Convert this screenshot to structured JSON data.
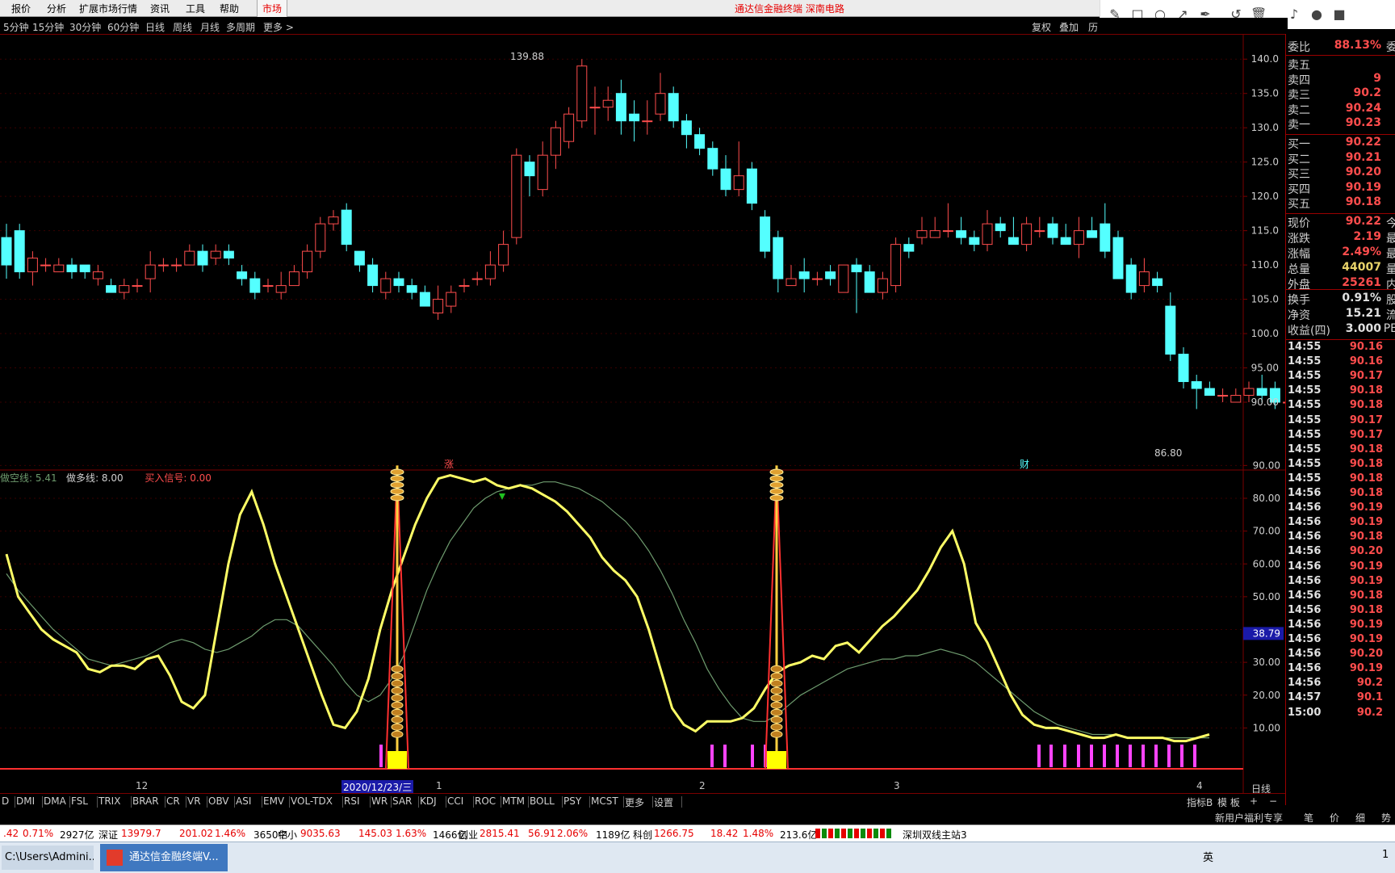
{
  "menu": {
    "items": [
      "报价",
      "分析",
      "扩展市场行情",
      "资讯",
      "工具",
      "帮助"
    ],
    "market": "市场",
    "title": "通达信金融终端  深南电路"
  },
  "periods": [
    "5分钟",
    "15分钟",
    "30分钟",
    "60分钟",
    "日线",
    "周线",
    "月线",
    "多周期",
    "更多 >"
  ],
  "period_right": [
    "复权",
    "叠加",
    "历"
  ],
  "chart": {
    "high_label": "139.88",
    "low_label": "86.80",
    "marker_zhang": "涨",
    "marker_cai": "财",
    "price_ticks": [
      "140.0",
      "135.0",
      "130.0",
      "125.0",
      "120.0",
      "115.0",
      "110.0",
      "105.0",
      "100.0",
      "95.00",
      "90.00"
    ],
    "ind_ticks": [
      "90.00",
      "80.00",
      "70.00",
      "60.00",
      "50.00",
      "40.00",
      "30.00",
      "20.00",
      "10.00"
    ],
    "cursor_value": "38.79",
    "x_labels": [
      "12",
      "2020/12/23/三",
      "1",
      "2",
      "3",
      "4"
    ],
    "period_label": "日线"
  },
  "chart_data": {
    "type": "candlestick",
    "price_axis": {
      "min": 86,
      "max": 140
    },
    "candles": [
      [
        114,
        110,
        116,
        108
      ],
      [
        115,
        109,
        116,
        108
      ],
      [
        109,
        111,
        112,
        107
      ],
      [
        110,
        110,
        111,
        109
      ],
      [
        109,
        110,
        111,
        109
      ],
      [
        110,
        109,
        111,
        108
      ],
      [
        110,
        109,
        110,
        108
      ],
      [
        108,
        109,
        110,
        107
      ],
      [
        107,
        106,
        108,
        106
      ],
      [
        106,
        107,
        108,
        105
      ],
      [
        107,
        107,
        108,
        106
      ],
      [
        108,
        110,
        112,
        106
      ],
      [
        110,
        110,
        111,
        109
      ],
      [
        110,
        110,
        111,
        109
      ],
      [
        110,
        112,
        113,
        110
      ],
      [
        112,
        110,
        113,
        109
      ],
      [
        111,
        112,
        113,
        110
      ],
      [
        112,
        111,
        113,
        110
      ],
      [
        109,
        108,
        110,
        107
      ],
      [
        108,
        106,
        109,
        105
      ],
      [
        107,
        107,
        108,
        106
      ],
      [
        106,
        107,
        109,
        105
      ],
      [
        107,
        109,
        110,
        107
      ],
      [
        109,
        112,
        113,
        108
      ],
      [
        112,
        116,
        117,
        111
      ],
      [
        116,
        117,
        118,
        115
      ],
      [
        118,
        113,
        119,
        112
      ],
      [
        112,
        110,
        112,
        109
      ],
      [
        110,
        107,
        111,
        106
      ],
      [
        106,
        108,
        109,
        105
      ],
      [
        108,
        107,
        109,
        106
      ],
      [
        107,
        106,
        108,
        105
      ],
      [
        106,
        104,
        107,
        104
      ],
      [
        103,
        105,
        107,
        102
      ],
      [
        104,
        106,
        107,
        103
      ],
      [
        107,
        107,
        108,
        106
      ],
      [
        108,
        108,
        109,
        107
      ],
      [
        108,
        110,
        112,
        107
      ],
      [
        110,
        113,
        115,
        109
      ],
      [
        114,
        126,
        127,
        113
      ],
      [
        125,
        123,
        126,
        120
      ],
      [
        121,
        126,
        128,
        120
      ],
      [
        126,
        130,
        131,
        124
      ],
      [
        128,
        132,
        133,
        127
      ],
      [
        131,
        139,
        140,
        130
      ],
      [
        133,
        133,
        136,
        129
      ],
      [
        133,
        134,
        136,
        131
      ],
      [
        135,
        131,
        137,
        129
      ],
      [
        132,
        131,
        134,
        128
      ],
      [
        131,
        131,
        134,
        129
      ],
      [
        132,
        135,
        138,
        131
      ],
      [
        135,
        131,
        136,
        130
      ],
      [
        131,
        129,
        132,
        127
      ],
      [
        129,
        127,
        130,
        126
      ],
      [
        127,
        124,
        128,
        123
      ],
      [
        124,
        121,
        126,
        120
      ],
      [
        121,
        123,
        128,
        120
      ],
      [
        124,
        119,
        125,
        118
      ],
      [
        117,
        112,
        118,
        111
      ],
      [
        114,
        108,
        115,
        106
      ],
      [
        107,
        108,
        110,
        107
      ],
      [
        109,
        108,
        111,
        106
      ],
      [
        108,
        108,
        109,
        107
      ],
      [
        109,
        108,
        110,
        107
      ],
      [
        106,
        110,
        110,
        106
      ],
      [
        110,
        109,
        111,
        103
      ],
      [
        109,
        106,
        110,
        106
      ],
      [
        106,
        108,
        109,
        105
      ],
      [
        107,
        113,
        114,
        106
      ],
      [
        113,
        112,
        114,
        111
      ],
      [
        114,
        115,
        117,
        113
      ],
      [
        114,
        115,
        117,
        114
      ],
      [
        115,
        115,
        119,
        114
      ],
      [
        115,
        114,
        117,
        113
      ],
      [
        114,
        113,
        115,
        112
      ],
      [
        113,
        116,
        118,
        112
      ],
      [
        116,
        115,
        117,
        114
      ],
      [
        114,
        113,
        117,
        113
      ],
      [
        113,
        116,
        117,
        112
      ],
      [
        115,
        115,
        117,
        114
      ],
      [
        116,
        114,
        117,
        113
      ],
      [
        114,
        113,
        116,
        113
      ],
      [
        113,
        115,
        117,
        111
      ],
      [
        115,
        114,
        117,
        114
      ],
      [
        116,
        112,
        119,
        111
      ],
      [
        114,
        108,
        115,
        108
      ],
      [
        110,
        106,
        111,
        105
      ],
      [
        107,
        109,
        111,
        106
      ],
      [
        108,
        107,
        109,
        106
      ],
      [
        104,
        97,
        106,
        96
      ],
      [
        97,
        93,
        98,
        92
      ],
      [
        93,
        92,
        94,
        89
      ],
      [
        92,
        91,
        93,
        91
      ],
      [
        91,
        91,
        92,
        90
      ],
      [
        90,
        91,
        92,
        90
      ],
      [
        91,
        92,
        93,
        90
      ],
      [
        92,
        91,
        94,
        90
      ],
      [
        92,
        90,
        93,
        89
      ],
      [
        90,
        90,
        91,
        89
      ],
      [
        90,
        89,
        91,
        87
      ],
      [
        89,
        89,
        90,
        88
      ],
      [
        89,
        88,
        90,
        87
      ],
      [
        88,
        88,
        89,
        87
      ],
      [
        88,
        90,
        91,
        88
      ]
    ],
    "indicator": {
      "series": [
        {
          "name": "做空线",
          "value": "5.41"
        },
        {
          "name": "做多线",
          "value": "8.00"
        },
        {
          "name": "买入信号",
          "value": "0.00"
        }
      ],
      "yellow": [
        63,
        50,
        45,
        40,
        37,
        35,
        33,
        28,
        27,
        29,
        29,
        28,
        31,
        32,
        26,
        18,
        16,
        20,
        40,
        60,
        75,
        82,
        72,
        60,
        50,
        40,
        30,
        20,
        11,
        10,
        15,
        25,
        40,
        52,
        62,
        72,
        80,
        86,
        87,
        86,
        85,
        86,
        84,
        83,
        84,
        83,
        81,
        79,
        76,
        72,
        68,
        62,
        58,
        55,
        50,
        40,
        28,
        16,
        11,
        9,
        12,
        12,
        12,
        13,
        16,
        22,
        27,
        29,
        30,
        32,
        31,
        35,
        36,
        33,
        37,
        41,
        44,
        48,
        52,
        58,
        65,
        70,
        60,
        42,
        36,
        28,
        20,
        14,
        11,
        10,
        10,
        9,
        8,
        7,
        7,
        8,
        7,
        7,
        7,
        7,
        6,
        6,
        7,
        8
      ],
      "green": [
        57,
        52,
        48,
        44,
        40,
        37,
        34,
        31,
        30,
        29,
        30,
        31,
        32,
        34,
        36,
        37,
        36,
        34,
        33,
        34,
        36,
        38,
        41,
        43,
        43,
        41,
        37,
        33,
        29,
        24,
        20,
        18,
        20,
        25,
        32,
        42,
        52,
        60,
        67,
        72,
        77,
        80,
        82,
        83,
        84,
        84,
        85,
        85,
        84,
        83,
        81,
        79,
        76,
        73,
        69,
        64,
        58,
        51,
        43,
        36,
        28,
        22,
        17,
        13,
        12,
        12,
        14,
        17,
        20,
        22,
        24,
        26,
        28,
        29,
        30,
        31,
        31,
        32,
        32,
        33,
        34,
        33,
        32,
        30,
        27,
        24,
        21,
        18,
        15,
        13,
        11,
        10,
        9,
        8,
        8,
        8,
        7,
        7,
        7,
        7,
        7,
        7,
        7,
        7
      ]
    }
  },
  "indicator_tabs": [
    "D",
    "DMI",
    "DMA",
    "FSL",
    "TRIX",
    "BRAR",
    "CR",
    "VR",
    "OBV",
    "ASI",
    "EMV",
    "VOL-TDX",
    "RSI",
    "WR",
    "SAR",
    "KDJ",
    "CCI",
    "ROC",
    "MTM",
    "BOLL",
    "PSY",
    "MCST",
    "更多",
    "设置"
  ],
  "indicator_tabs_right": [
    "指标B",
    "模 板",
    "+",
    "−"
  ],
  "quote": {
    "wei_bi": {
      "label": "委比",
      "value": "88.13%",
      "tail": "委"
    },
    "sells": [
      {
        "label": "卖五",
        "value": ""
      },
      {
        "label": "卖四",
        "value": "9"
      },
      {
        "label": "卖三",
        "value": "90.2"
      },
      {
        "label": "卖二",
        "value": "90.24"
      },
      {
        "label": "卖一",
        "value": "90.23"
      }
    ],
    "buys": [
      {
        "label": "买一",
        "value": "90.22"
      },
      {
        "label": "买二",
        "value": "90.21"
      },
      {
        "label": "买三",
        "value": "90.20"
      },
      {
        "label": "买四",
        "value": "90.19"
      },
      {
        "label": "买五",
        "value": "90.18"
      }
    ],
    "stats": [
      {
        "label": "现价",
        "value": "90.22",
        "tail": "今",
        "color": "#ff4d4d"
      },
      {
        "label": "涨跌",
        "value": "2.19",
        "tail": "最",
        "color": "#ff4d4d"
      },
      {
        "label": "涨幅",
        "value": "2.49%",
        "tail": "最",
        "color": "#ff4d4d"
      },
      {
        "label": "总量",
        "value": "44007",
        "tail": "量",
        "color": "#e8d36a"
      },
      {
        "label": "外盘",
        "value": "25261",
        "tail": "内",
        "color": "#ff4d4d"
      },
      {
        "label": "换手",
        "value": "0.91%",
        "tail": "股",
        "color": "#e0e0e0"
      },
      {
        "label": "净资",
        "value": "15.21",
        "tail": "流",
        "color": "#e0e0e0"
      },
      {
        "label": "收益(四)",
        "value": "3.000",
        "tail": "PE",
        "color": "#e0e0e0"
      }
    ],
    "ticks": [
      [
        "14:55",
        "90.16"
      ],
      [
        "14:55",
        "90.16"
      ],
      [
        "14:55",
        "90.17"
      ],
      [
        "14:55",
        "90.18"
      ],
      [
        "14:55",
        "90.18"
      ],
      [
        "14:55",
        "90.17"
      ],
      [
        "14:55",
        "90.17"
      ],
      [
        "14:55",
        "90.18"
      ],
      [
        "14:55",
        "90.18"
      ],
      [
        "14:55",
        "90.18"
      ],
      [
        "14:56",
        "90.18"
      ],
      [
        "14:56",
        "90.19"
      ],
      [
        "14:56",
        "90.19"
      ],
      [
        "14:56",
        "90.18"
      ],
      [
        "14:56",
        "90.20"
      ],
      [
        "14:56",
        "90.19"
      ],
      [
        "14:56",
        "90.19"
      ],
      [
        "14:56",
        "90.18"
      ],
      [
        "14:56",
        "90.18"
      ],
      [
        "14:56",
        "90.19"
      ],
      [
        "14:56",
        "90.19"
      ],
      [
        "14:56",
        "90.20"
      ],
      [
        "14:56",
        "90.19"
      ],
      [
        "14:56",
        "90.2"
      ],
      [
        "14:57",
        "90.1"
      ],
      [
        "15:00",
        "90.2"
      ]
    ]
  },
  "statusbar": [
    {
      "text": ".42",
      "color": "#e60000"
    },
    {
      "text": "0.71%",
      "color": "#e60000"
    },
    {
      "text": "2927亿",
      "color": "#000"
    },
    {
      "text": "深证",
      "color": "#000"
    },
    {
      "text": "13979.7",
      "color": "#e60000"
    },
    {
      "text": "201.02",
      "color": "#e60000"
    },
    {
      "text": "1.46%",
      "color": "#e60000"
    },
    {
      "text": "3650亿",
      "color": "#000"
    },
    {
      "text": "中小",
      "color": "#000"
    },
    {
      "text": "9035.63",
      "color": "#e60000"
    },
    {
      "text": "145.03",
      "color": "#e60000"
    },
    {
      "text": "1.63%",
      "color": "#e60000"
    },
    {
      "text": "1466亿",
      "color": "#000"
    },
    {
      "text": "创业",
      "color": "#000"
    },
    {
      "text": "2815.41",
      "color": "#e60000"
    },
    {
      "text": "56.91",
      "color": "#e60000"
    },
    {
      "text": "2.06%",
      "color": "#e60000"
    },
    {
      "text": "1189亿",
      "color": "#000"
    },
    {
      "text": "科创",
      "color": "#000"
    },
    {
      "text": "1266.75",
      "color": "#e60000"
    },
    {
      "text": "18.42",
      "color": "#e60000"
    },
    {
      "text": "1.48%",
      "color": "#e60000"
    },
    {
      "text": "213.6亿",
      "color": "#000"
    },
    {
      "text": "深圳双线主站3",
      "color": "#000"
    }
  ],
  "promo": [
    "新用户福利专享",
    "笔",
    "价",
    "细",
    "势"
  ],
  "taskbar": {
    "cmd": "C:\\Users\\Admini...",
    "tdx": "通达信金融终端V...",
    "tray": "英",
    "clock": "1"
  },
  "colors": {
    "up": "#ff4d4d",
    "down": "#54ffff",
    "yellow": "#ffff66",
    "green": "#6e9b6e",
    "magenta": "#ff44ff",
    "grid": "#7a0000"
  }
}
